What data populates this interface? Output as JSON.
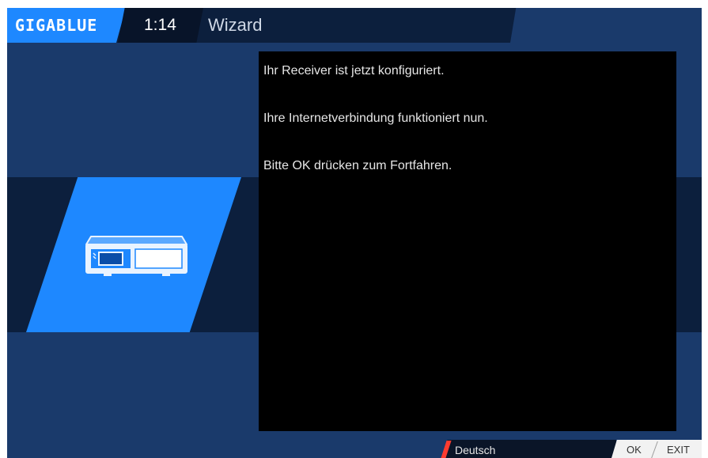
{
  "header": {
    "logo": "GIGABLUE",
    "clock": "1:14",
    "title": "Wizard"
  },
  "illustration": {
    "icon": "receiver-icon"
  },
  "message": {
    "lines": [
      "Ihr Receiver ist jetzt konfiguriert.",
      "Ihre Internetverbindung funktioniert nun.",
      "Bitte OK drücken zum Fortfahren."
    ]
  },
  "footer": {
    "language": "Deutsch",
    "keys": [
      "OK",
      "EXIT"
    ]
  },
  "colors": {
    "accent": "#1e88ff",
    "background": "#1a3a6b",
    "dark_band": "#0c1f3d",
    "language_marker": "#ff3b2f"
  }
}
